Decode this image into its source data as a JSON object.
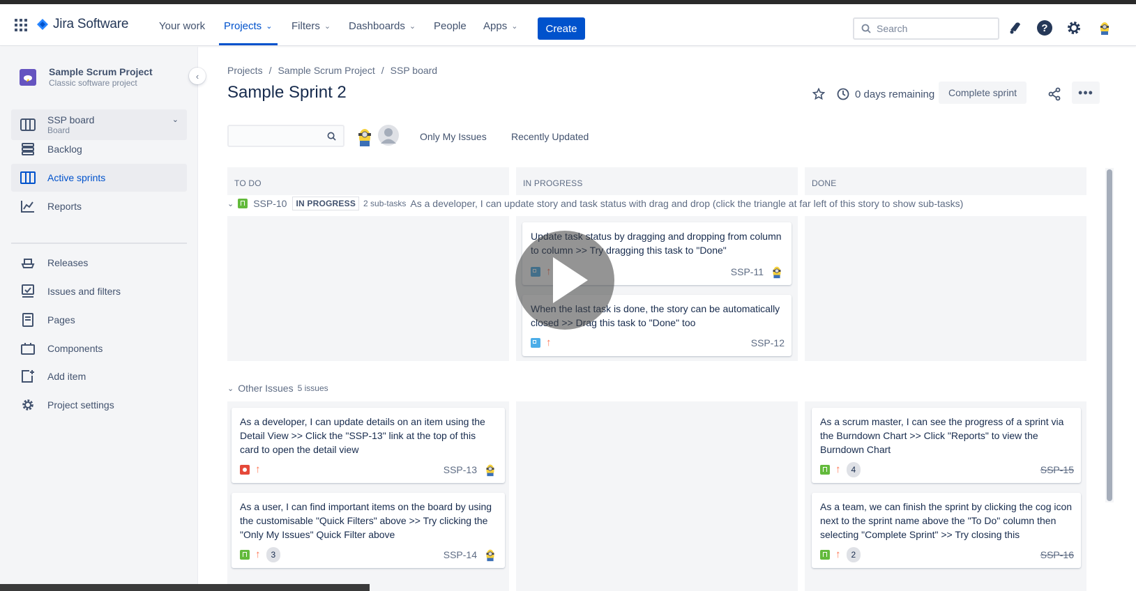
{
  "topnav": {
    "logo_text": "Jira Software",
    "items": [
      "Your work",
      "Projects",
      "Filters",
      "Dashboards",
      "People",
      "Apps"
    ],
    "create_label": "Create",
    "search_placeholder": "Search"
  },
  "sidebar": {
    "project_name": "Sample Scrum Project",
    "project_type": "Classic software project",
    "board_label": "SSP board",
    "board_sub": "Board",
    "items": [
      "Backlog",
      "Active sprints",
      "Reports"
    ],
    "items2": [
      "Releases",
      "Issues and filters",
      "Pages",
      "Components",
      "Add item",
      "Project settings"
    ]
  },
  "header": {
    "breadcrumb": [
      "Projects",
      "Sample Scrum Project",
      "SSP board"
    ],
    "title": "Sample Sprint 2",
    "days_remaining": "0 days remaining",
    "complete_sprint": "Complete sprint"
  },
  "filters": {
    "quick": [
      "Only My Issues",
      "Recently Updated"
    ]
  },
  "columns": [
    "TO DO",
    "IN PROGRESS",
    "DONE"
  ],
  "swimlanes": [
    {
      "key": "SSP-10",
      "status": "IN PROGRESS",
      "count": "2 sub-tasks",
      "summary": "As a developer, I can update story and task status with drag and drop (click the triangle at far left of this story to show sub-tasks)"
    },
    {
      "title": "Other Issues",
      "count": "5 issues"
    }
  ],
  "cards": {
    "ssp11": {
      "summary": "Update task status by dragging and dropping from column to column >> Try dragging this task to \"Done\"",
      "key": "SSP-11"
    },
    "ssp12": {
      "summary": "When the last task is done, the story can be automatically closed >> Drag this task to \"Done\" too",
      "key": "SSP-12"
    },
    "ssp13": {
      "summary": "As a developer, I can update details on an item using the Detail View >> Click the \"SSP-13\" link at the top of this card to open the detail view",
      "key": "SSP-13"
    },
    "ssp14": {
      "summary": "As a user, I can find important items on the board by using the customisable \"Quick Filters\" above >> Try clicking the \"Only My Issues\" Quick Filter above",
      "key": "SSP-14",
      "estimate": "3"
    },
    "ssp15": {
      "summary": "As a scrum master, I can see the progress of a sprint via the Burndown Chart >> Click \"Reports\" to view the Burndown Chart",
      "key": "SSP-15",
      "estimate": "4"
    },
    "ssp16": {
      "summary": "As a team, we can finish the sprint by clicking the cog icon next to the sprint name above the \"To Do\" column then selecting \"Complete Sprint\" >> Try closing this",
      "key": "SSP-16",
      "estimate": "2"
    }
  },
  "colors": {
    "brand": "#0052cc",
    "story": "#63ba3c",
    "subtask": "#4bade8",
    "bug": "#e5493a",
    "priority_high": "#ff7452"
  }
}
